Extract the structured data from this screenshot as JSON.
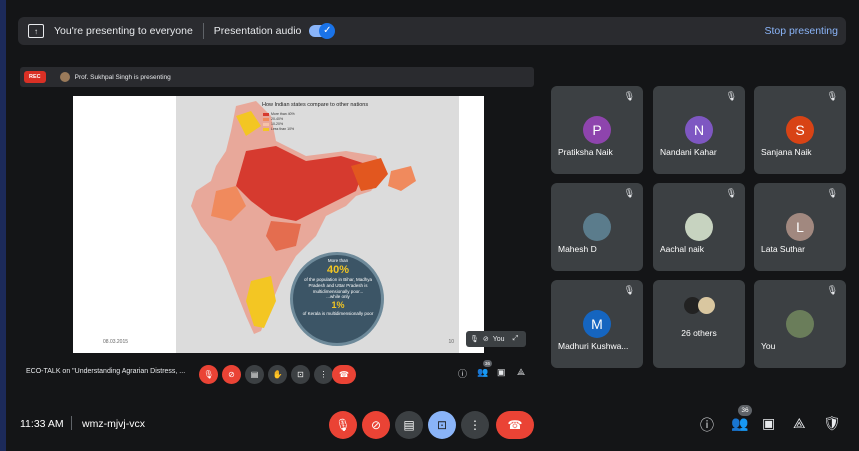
{
  "banner": {
    "presenting_text": "You're presenting to everyone",
    "audio_label": "Presentation audio",
    "audio_enabled": true,
    "stop_label": "Stop presenting"
  },
  "presenter_bar": {
    "rec_label": "REC",
    "presenter_text": "Prof. Sukhpal Singh is presenting"
  },
  "slide": {
    "title": "How Indian states compare to other nations",
    "legend": [
      "More than 40%",
      "20-40%",
      "10-20%",
      "Less than 10%"
    ],
    "stat_intro": "More than",
    "stat_big": "40%",
    "stat_text": "of the population in Bihar, Madhya Pradesh and Uttar Pradesh is multidimensionally poor...",
    "stat_intro2": "...while only",
    "stat_big2": "1%",
    "stat_text2": "of Kerala is multidimensionally poor",
    "date": "08.03.2015",
    "page": "10"
  },
  "pip": {
    "you_label": "You"
  },
  "caption": "ECO-TALK on \"Understanding Agrarian Distress, ...",
  "participants": [
    {
      "name": "Pratiksha Naik",
      "initial": "P",
      "color": "#8e44ad",
      "muted": true
    },
    {
      "name": "Nandani Kahar",
      "initial": "N",
      "color": "#7e57c2",
      "muted": true
    },
    {
      "name": "Sanjana Naik",
      "initial": "S",
      "color": "#d84315",
      "muted": true
    },
    {
      "name": "Mahesh D",
      "initial": "",
      "color": "#5b7c8c",
      "muted": true
    },
    {
      "name": "Aachal naik",
      "initial": "",
      "color": "#c7d3c0",
      "muted": true
    },
    {
      "name": "Lata Suthar",
      "initial": "L",
      "color": "#a1887f",
      "muted": true
    },
    {
      "name": "Madhuri Kushwa...",
      "initial": "M",
      "color": "#1565c0",
      "muted": true
    },
    {
      "name": "26 others",
      "initial": "",
      "color": "",
      "muted": false
    },
    {
      "name": "You",
      "initial": "",
      "color": "#6a7d5a",
      "muted": true
    }
  ],
  "bottom": {
    "time": "11:33 AM",
    "meeting_code": "wmz-mjvj-vcx",
    "people_count": "36",
    "mini_people_count": "36"
  },
  "colors": {
    "accent": "#8ab4f8",
    "danger": "#ea4335",
    "tile": "#3c4043"
  }
}
